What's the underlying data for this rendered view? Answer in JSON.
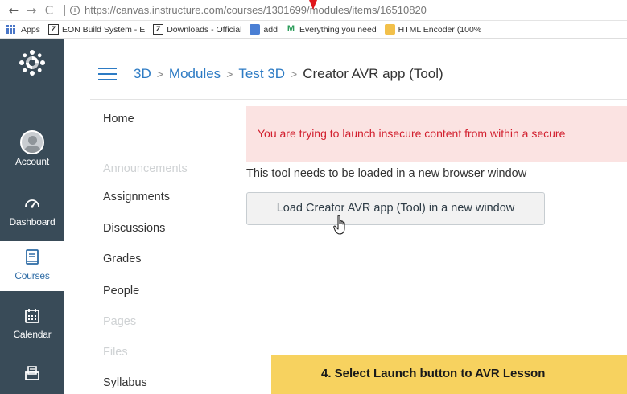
{
  "browser": {
    "url_host": "https://canvas.instructure.com",
    "url_path": "/courses/1301699/modules/items/16510820",
    "bookmarks": [
      {
        "label": "Apps"
      },
      {
        "label": "EON Build System - E"
      },
      {
        "label": "Downloads - Official"
      },
      {
        "label": "add"
      },
      {
        "label": "Everything you need"
      },
      {
        "label": "HTML Encoder (100%"
      }
    ]
  },
  "global_nav": {
    "items": [
      {
        "label": "Account",
        "icon": "avatar-icon"
      },
      {
        "label": "Dashboard",
        "icon": "dashboard-icon"
      },
      {
        "label": "Courses",
        "icon": "courses-icon",
        "active": true
      },
      {
        "label": "Calendar",
        "icon": "calendar-icon"
      },
      {
        "label": "",
        "icon": "inbox-icon"
      }
    ]
  },
  "breadcrumb": {
    "items": [
      "3D",
      "Modules",
      "Test 3D"
    ],
    "current": "Creator AVR app (Tool)",
    "separator": ">"
  },
  "course_nav": {
    "items": [
      {
        "label": "Home"
      },
      {
        "label": "Announcements",
        "disabled": true
      },
      {
        "label": "Assignments"
      },
      {
        "label": "Discussions"
      },
      {
        "label": "Grades"
      },
      {
        "label": "People"
      },
      {
        "label": "Pages",
        "disabled": true
      },
      {
        "label": "Files",
        "disabled": true
      },
      {
        "label": "Syllabus"
      }
    ]
  },
  "content": {
    "alert": "You are trying to launch insecure content from within a secure",
    "message": "This tool needs to be loaded in a new browser window",
    "launch_button": "Load Creator AVR app (Tool) in a new window"
  },
  "callout": {
    "text": "4. Select Launch button to AVR Lesson"
  },
  "colors": {
    "nav_bg": "#394b58",
    "link": "#2d7bc4",
    "alert_bg": "#fbe3e2",
    "alert_text": "#d2202f",
    "callout_bg": "#f7d25f",
    "arrow": "#e0161b"
  }
}
